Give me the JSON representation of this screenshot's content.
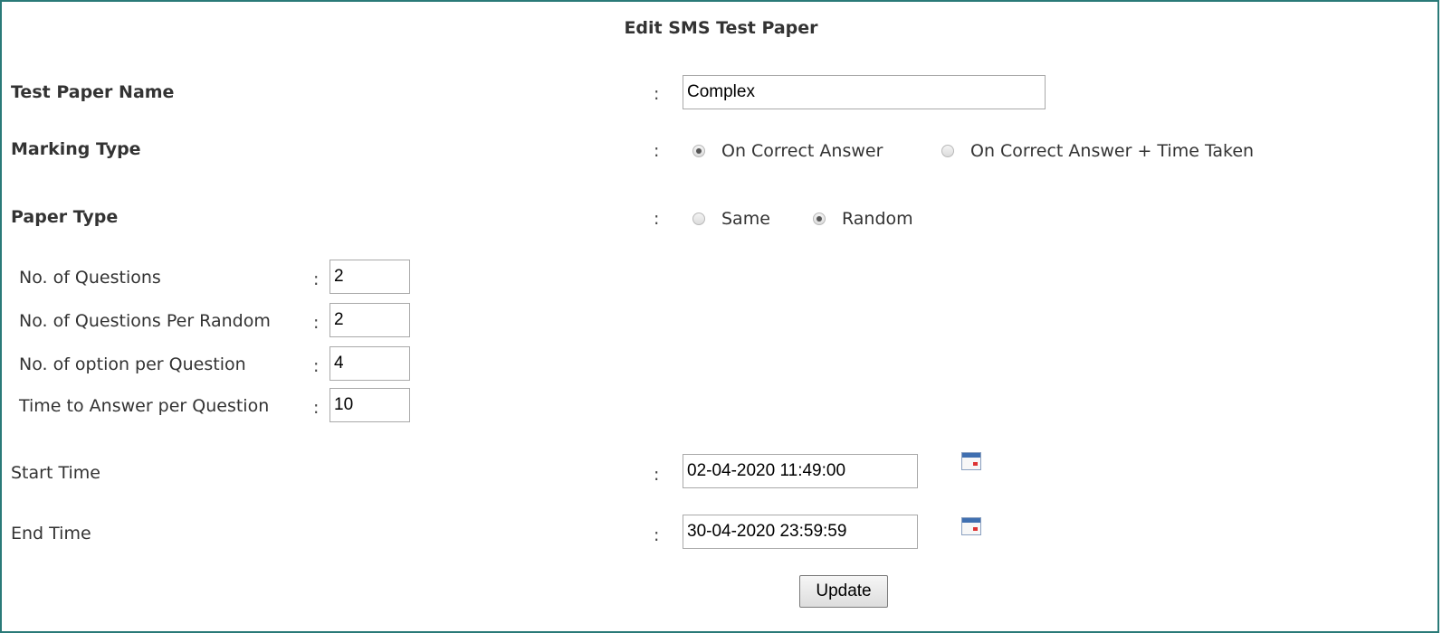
{
  "form": {
    "title": "Edit SMS Test Paper",
    "colon": ":",
    "test_paper_name": {
      "label": "Test Paper Name",
      "value": "Complex"
    },
    "marking_type": {
      "label": "Marking Type",
      "options": [
        {
          "label": "On Correct Answer",
          "checked": true
        },
        {
          "label": "On Correct Answer + Time Taken",
          "checked": false
        }
      ]
    },
    "paper_type": {
      "label": "Paper Type",
      "options": [
        {
          "label": "Same",
          "checked": false
        },
        {
          "label": "Random",
          "checked": true
        }
      ]
    },
    "random_settings": [
      {
        "label": "No. of Questions",
        "value": "2"
      },
      {
        "label": "No. of Questions Per Random",
        "value": "2"
      },
      {
        "label": "No. of option per Question",
        "value": "4"
      },
      {
        "label": "Time to Answer per Question",
        "value": "10"
      }
    ],
    "start_time": {
      "label": "Start Time",
      "value": "02-04-2020 11:49:00"
    },
    "end_time": {
      "label": "End Time",
      "value": "30-04-2020 23:59:59"
    },
    "update_label": "Update"
  }
}
